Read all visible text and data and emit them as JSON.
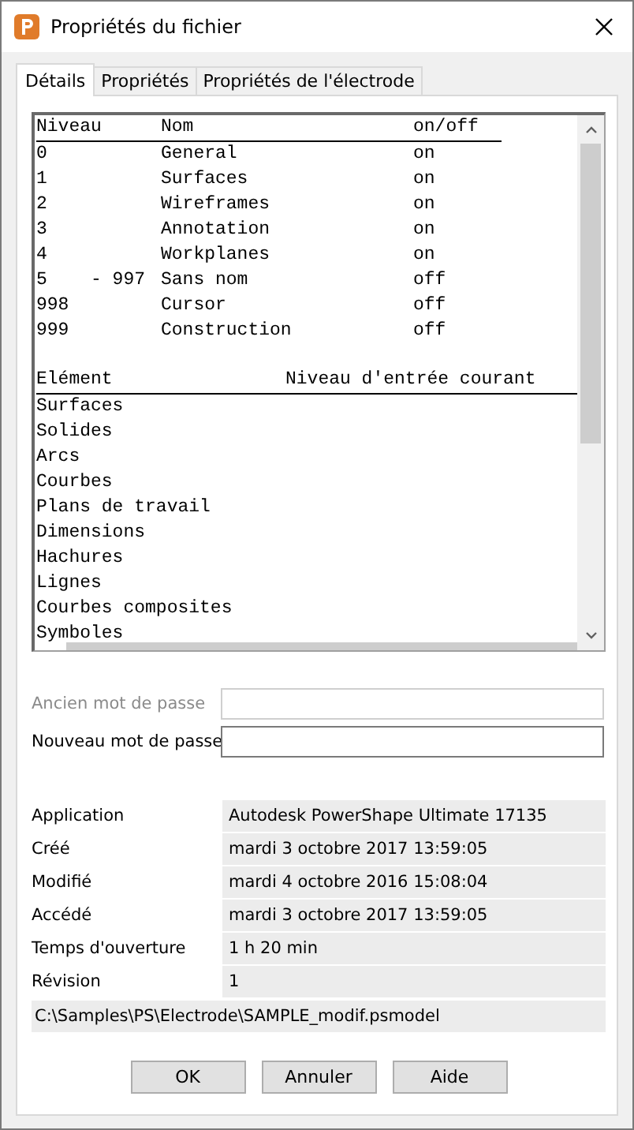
{
  "window": {
    "title": "Propriétés du fichier"
  },
  "tabs": [
    {
      "label": "Détails",
      "selected": true
    },
    {
      "label": "Propriétés",
      "selected": false
    },
    {
      "label": "Propriétés de l'électrode",
      "selected": false
    }
  ],
  "levels": {
    "columns": [
      "Niveau",
      "Nom",
      "on/off"
    ],
    "rows": [
      {
        "level": "0",
        "name": "General",
        "state": "on"
      },
      {
        "level": "1",
        "name": "Surfaces",
        "state": "on"
      },
      {
        "level": "2",
        "name": "Wireframes",
        "state": "on"
      },
      {
        "level": "3",
        "name": "Annotation",
        "state": "on"
      },
      {
        "level": "4",
        "name": "Workplanes",
        "state": "on"
      },
      {
        "level": "5    - 997",
        "name": "Sans nom",
        "state": "off"
      },
      {
        "level": "998",
        "name": "Cursor",
        "state": "off"
      },
      {
        "level": "999",
        "name": "Construction",
        "state": "off"
      }
    ]
  },
  "elements": {
    "columns": [
      "Elément",
      "Niveau d'entrée courant"
    ],
    "rows": [
      "Surfaces",
      "Solides",
      "Arcs",
      "Courbes",
      "Plans de travail",
      "Dimensions",
      "Hachures",
      "Lignes",
      "Courbes composites",
      "Symboles"
    ]
  },
  "password_fields": [
    {
      "label": "Ancien mot de passe",
      "disabled": true
    },
    {
      "label": "Nouveau mot de passe",
      "disabled": false
    }
  ],
  "info": [
    {
      "label": "Application",
      "value": "Autodesk PowerShape Ultimate 17135"
    },
    {
      "label": "Créé",
      "value": "mardi 3 octobre 2017 13:59:05"
    },
    {
      "label": "Modifié",
      "value": "mardi 4 octobre 2016 15:08:04"
    },
    {
      "label": "Accédé",
      "value": "mardi 3 octobre 2017 13:59:05"
    },
    {
      "label": "Temps d'ouverture",
      "value": "1 h 20 min"
    },
    {
      "label": "Révision",
      "value": "1"
    }
  ],
  "path": "C:\\Samples\\PS\\Electrode\\SAMPLE_modif.psmodel",
  "buttons": [
    "OK",
    "Annuler",
    "Aide"
  ]
}
